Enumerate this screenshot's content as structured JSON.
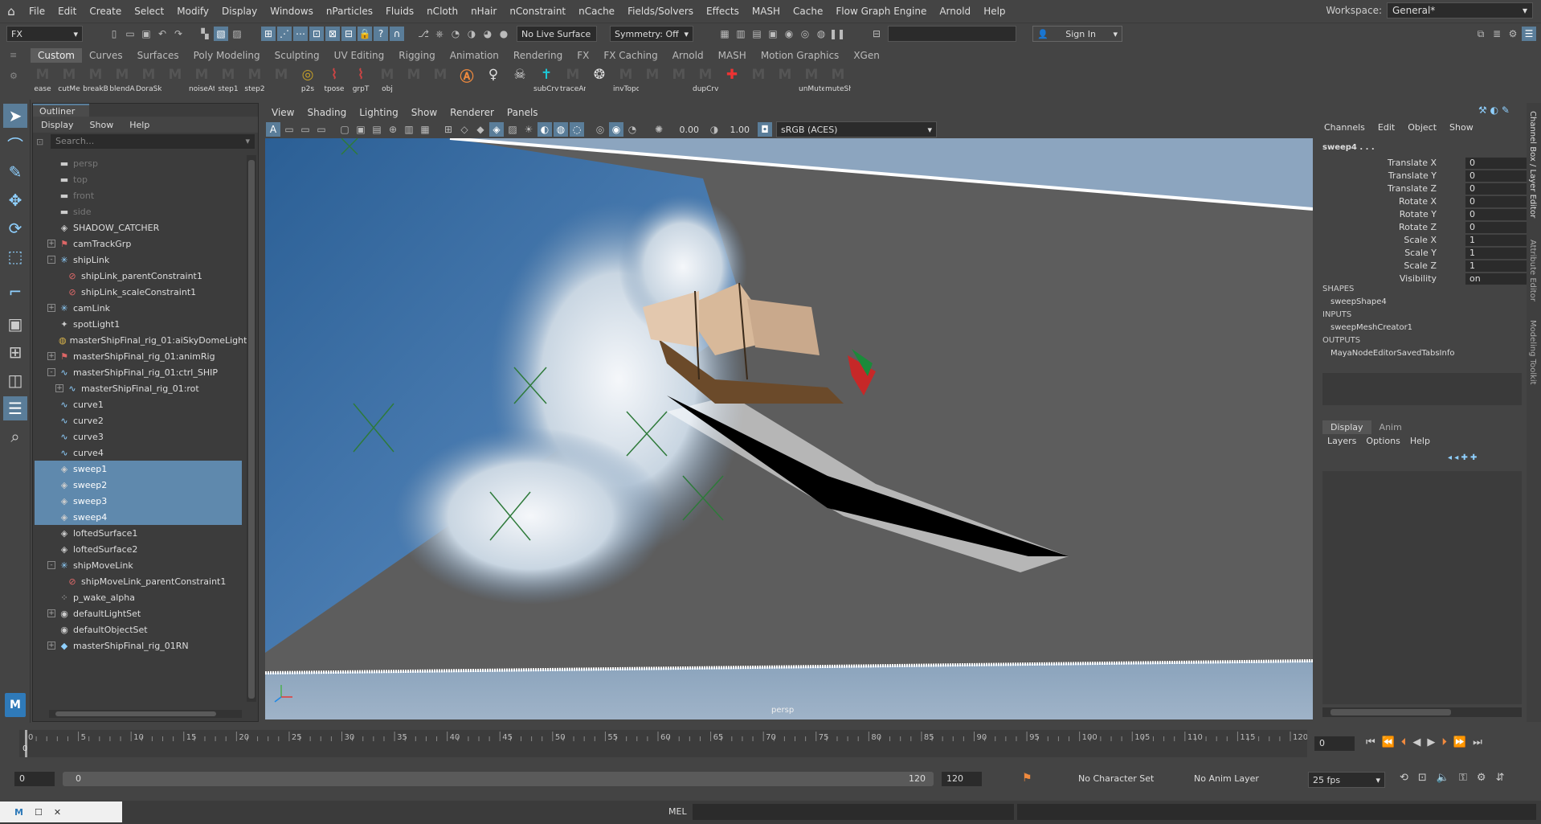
{
  "menubar": {
    "items": [
      "File",
      "Edit",
      "Create",
      "Select",
      "Modify",
      "Display",
      "Windows",
      "nParticles",
      "Fluids",
      "nCloth",
      "nHair",
      "nConstraint",
      "nCache",
      "Fields/Solvers",
      "Effects",
      "MASH",
      "Cache",
      "Flow Graph Engine",
      "Arnold",
      "Help"
    ],
    "workspace_label": "Workspace:",
    "workspace_value": "General*"
  },
  "status": {
    "menuset": "FX",
    "live_surface": "No Live Surface",
    "symmetry": "Symmetry: Off",
    "sign_in": "Sign In"
  },
  "shelf": {
    "tabs": [
      "Custom",
      "Curves",
      "Surfaces",
      "Poly Modeling",
      "Sculpting",
      "UV Editing",
      "Rigging",
      "Animation",
      "Rendering",
      "FX",
      "FX Caching",
      "Arnold",
      "MASH",
      "Motion Graphics",
      "XGen"
    ],
    "buttons": [
      {
        "label": "ease"
      },
      {
        "label": "cutMe"
      },
      {
        "label": "breakB"
      },
      {
        "label": "blendA"
      },
      {
        "label": "DoraSk"
      },
      {
        "label": ""
      },
      {
        "label": "noiseAt"
      },
      {
        "label": "step1"
      },
      {
        "label": "step2"
      },
      {
        "label": ""
      },
      {
        "label": "p2s"
      },
      {
        "label": "tpose"
      },
      {
        "label": "grpT"
      },
      {
        "label": "obj"
      },
      {
        "label": ""
      },
      {
        "label": ""
      },
      {
        "label": ""
      },
      {
        "label": ""
      },
      {
        "label": ""
      },
      {
        "label": "subCrvl"
      },
      {
        "label": "traceAn"
      },
      {
        "label": ""
      },
      {
        "label": "invTopo"
      },
      {
        "label": ""
      },
      {
        "label": ""
      },
      {
        "label": "dupCrv"
      },
      {
        "label": ""
      },
      {
        "label": ""
      },
      {
        "label": ""
      },
      {
        "label": "unMute"
      },
      {
        "label": "muteSh"
      }
    ]
  },
  "outliner": {
    "title": "Outliner",
    "menu": [
      "Display",
      "Show",
      "Help"
    ],
    "search_placeholder": "Search...",
    "items": [
      {
        "label": "persp",
        "icon": "camera-icon",
        "dim": true,
        "exp": "",
        "indent": 0
      },
      {
        "label": "top",
        "icon": "camera-icon",
        "dim": true,
        "exp": "",
        "indent": 0
      },
      {
        "label": "front",
        "icon": "camera-icon",
        "dim": true,
        "exp": "",
        "indent": 0
      },
      {
        "label": "side",
        "icon": "camera-icon",
        "dim": true,
        "exp": "",
        "indent": 0
      },
      {
        "label": "SHADOW_CATCHER",
        "icon": "mesh-icon",
        "exp": "",
        "indent": 0
      },
      {
        "label": "camTrackGrp",
        "icon": "group-icon",
        "exp": "+",
        "indent": 0
      },
      {
        "label": "shipLink",
        "icon": "locator-icon",
        "exp": "-",
        "indent": 0
      },
      {
        "label": "shipLink_parentConstraint1",
        "icon": "constraint-icon",
        "exp": "",
        "indent": 1
      },
      {
        "label": "shipLink_scaleConstraint1",
        "icon": "constraint-icon",
        "exp": "",
        "indent": 1
      },
      {
        "label": "camLink",
        "icon": "locator-icon",
        "exp": "+",
        "indent": 0
      },
      {
        "label": "spotLight1",
        "icon": "light-icon",
        "exp": "",
        "indent": 0
      },
      {
        "label": "masterShipFinal_rig_01:aiSkyDomeLight",
        "icon": "skydome-icon",
        "exp": "",
        "indent": 0
      },
      {
        "label": "masterShipFinal_rig_01:animRig",
        "icon": "group-icon",
        "exp": "+",
        "indent": 0
      },
      {
        "label": "masterShipFinal_rig_01:ctrl_SHIP",
        "icon": "curve-icon",
        "exp": "-",
        "indent": 0
      },
      {
        "label": "masterShipFinal_rig_01:rot",
        "icon": "curve-icon",
        "exp": "+",
        "indent": 1
      },
      {
        "label": "curve1",
        "icon": "curve-icon",
        "exp": "",
        "indent": 0
      },
      {
        "label": "curve2",
        "icon": "curve-icon",
        "exp": "",
        "indent": 0
      },
      {
        "label": "curve3",
        "icon": "curve-icon",
        "exp": "",
        "indent": 0
      },
      {
        "label": "curve4",
        "icon": "curve-icon",
        "exp": "",
        "indent": 0
      },
      {
        "label": "sweep1",
        "icon": "mesh-icon",
        "exp": "",
        "indent": 0,
        "sel": true
      },
      {
        "label": "sweep2",
        "icon": "mesh-icon",
        "exp": "",
        "indent": 0,
        "sel": true
      },
      {
        "label": "sweep3",
        "icon": "mesh-icon",
        "exp": "",
        "indent": 0,
        "sel": true
      },
      {
        "label": "sweep4",
        "icon": "mesh-icon",
        "exp": "",
        "indent": 0,
        "sel": true
      },
      {
        "label": "loftedSurface1",
        "icon": "mesh-icon",
        "exp": "",
        "indent": 0
      },
      {
        "label": "loftedSurface2",
        "icon": "mesh-icon",
        "exp": "",
        "indent": 0
      },
      {
        "label": "shipMoveLink",
        "icon": "locator-icon",
        "exp": "-",
        "indent": 0
      },
      {
        "label": "shipMoveLink_parentConstraint1",
        "icon": "constraint-icon",
        "exp": "",
        "indent": 1
      },
      {
        "label": "p_wake_alpha",
        "icon": "particle-icon",
        "exp": "",
        "indent": 0
      },
      {
        "label": "defaultLightSet",
        "icon": "set-icon",
        "exp": "+",
        "indent": 0
      },
      {
        "label": "defaultObjectSet",
        "icon": "set-icon",
        "exp": "",
        "indent": 0
      },
      {
        "label": "masterShipFinal_rig_01RN",
        "icon": "reference-icon",
        "exp": "+",
        "indent": 0
      }
    ]
  },
  "viewport": {
    "menu": [
      "View",
      "Shading",
      "Lighting",
      "Show",
      "Renderer",
      "Panels"
    ],
    "exposure": "0.00",
    "gamma": "1.00",
    "colorspace": "sRGB (ACES)",
    "camera_label": "persp"
  },
  "channelbox": {
    "menu": [
      "Channels",
      "Edit",
      "Object",
      "Show"
    ],
    "node": "sweep4 . . .",
    "attrs": [
      {
        "k": "Translate X",
        "v": "0"
      },
      {
        "k": "Translate Y",
        "v": "0"
      },
      {
        "k": "Translate Z",
        "v": "0"
      },
      {
        "k": "Rotate X",
        "v": "0"
      },
      {
        "k": "Rotate Y",
        "v": "0"
      },
      {
        "k": "Rotate Z",
        "v": "0"
      },
      {
        "k": "Scale X",
        "v": "1"
      },
      {
        "k": "Scale Y",
        "v": "1"
      },
      {
        "k": "Scale Z",
        "v": "1"
      },
      {
        "k": "Visibility",
        "v": "on"
      }
    ],
    "shapes_h": "SHAPES",
    "shape": "sweepShape4",
    "inputs_h": "INPUTS",
    "input": "sweepMeshCreator1",
    "outputs_h": "OUTPUTS",
    "output": "MayaNodeEditorSavedTabsInfo",
    "layer_tabs": [
      "Display",
      "Anim"
    ],
    "layer_menu": [
      "Layers",
      "Options",
      "Help"
    ],
    "side_tabs": [
      "Channel Box / Layer Editor",
      "Attribute Editor",
      "Modeling Toolkit"
    ]
  },
  "timeline": {
    "ticks": [
      "0",
      "5",
      "10",
      "15",
      "20",
      "25",
      "30",
      "35",
      "40",
      "45",
      "50",
      "55",
      "60",
      "65",
      "70",
      "75",
      "80",
      "85",
      "90",
      "95",
      "100",
      "105",
      "110",
      "115",
      "120"
    ],
    "current_frame": "0",
    "frame_field": "0"
  },
  "range": {
    "start": "0",
    "inner_start": "0",
    "inner_end": "120",
    "end": "120",
    "character_set": "No Character Set",
    "anim_layer": "No Anim Layer",
    "fps": "25 fps"
  },
  "cmd": {
    "mode": "MEL"
  },
  "colors": {
    "selection": "#5f89ad",
    "accent": "#5a7d99"
  }
}
